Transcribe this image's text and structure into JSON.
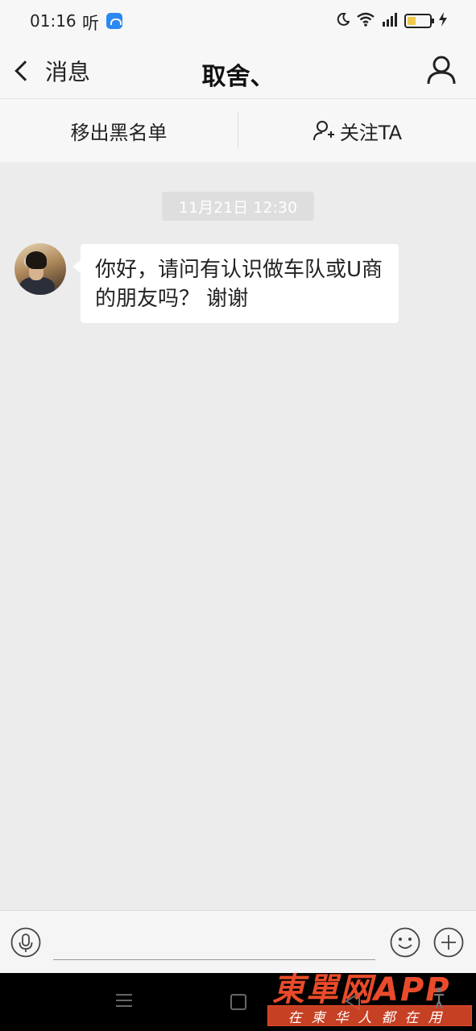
{
  "status_bar": {
    "time": "01:16",
    "listen_label": "听",
    "icons": [
      "app-notification-icon",
      "moon-icon",
      "wifi-icon",
      "signal-icon",
      "battery-icon",
      "charging-icon"
    ]
  },
  "nav": {
    "back_label": "消息",
    "title": "取舍、",
    "profile_icon": "person-icon"
  },
  "actions": {
    "remove_blacklist": "移出黑名单",
    "follow": "关注TA",
    "follow_icon": "add-person-icon"
  },
  "chat": {
    "timestamp": "11月21日 12:30",
    "messages": [
      {
        "sender": "other",
        "text": "你好，请问有认识做车队或U商的朋友吗？ 谢谢"
      }
    ]
  },
  "input_bar": {
    "voice_icon": "microphone-icon",
    "placeholder": "",
    "emoji_icon": "smiley-icon",
    "plus_icon": "plus-icon"
  },
  "system_nav": {
    "buttons": [
      "menu-icon",
      "home-icon",
      "back-triangle-icon"
    ]
  },
  "watermark": {
    "title": "東單网APP",
    "subtitle": "在柬华人都在用"
  },
  "colors": {
    "background": "#ececec",
    "bar": "#f7f7f7",
    "bubble": "#ffffff",
    "timestamp_bg": "#dedede",
    "watermark": "#e94b2a"
  }
}
